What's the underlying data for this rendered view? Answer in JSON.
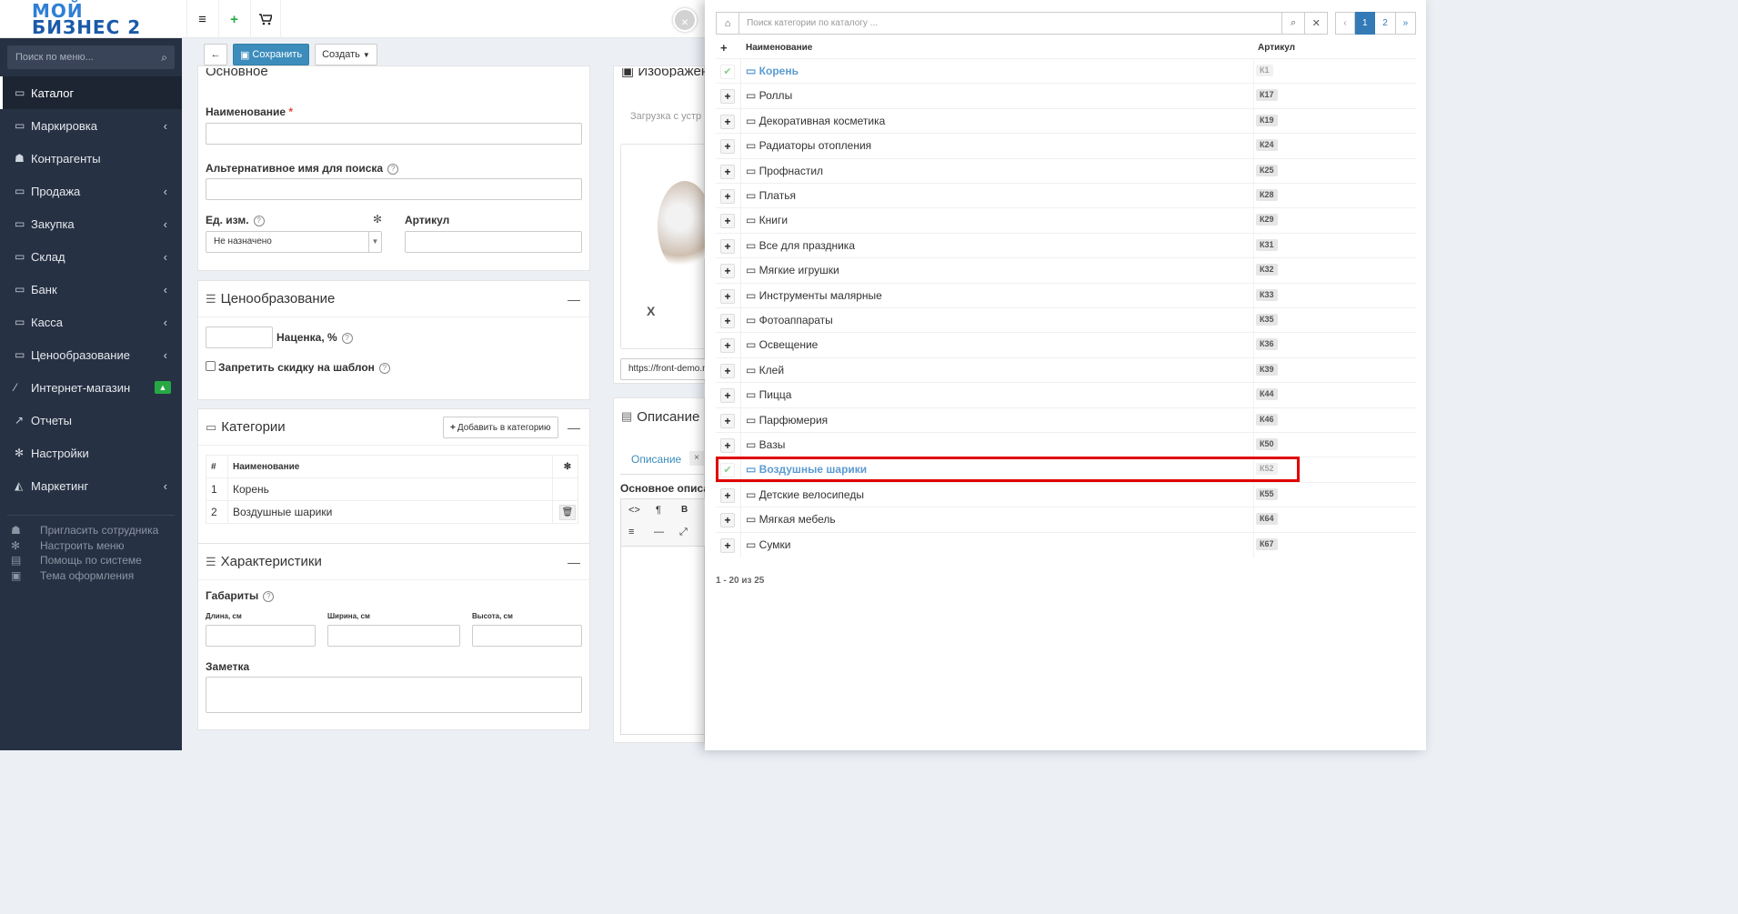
{
  "app": {
    "logo_line1": "МОЙ",
    "logo_line2": "БИЗНЕС 2"
  },
  "topbar": {
    "menu_icon": "hamburger-icon",
    "add_icon": "plus-icon",
    "cart_icon": "cart-icon"
  },
  "sidebar": {
    "search_placeholder": "Поиск по меню...",
    "items": [
      {
        "label": "Каталог",
        "icon": "folder-icon"
      },
      {
        "label": "Маркировка",
        "icon": "folder-icon"
      },
      {
        "label": "Контрагенты",
        "icon": "users-icon"
      },
      {
        "label": "Продажа",
        "icon": "folder-icon"
      },
      {
        "label": "Закупка",
        "icon": "folder-icon"
      },
      {
        "label": "Склад",
        "icon": "folder-icon"
      },
      {
        "label": "Банк",
        "icon": "folder-icon"
      },
      {
        "label": "Касса",
        "icon": "folder-icon"
      },
      {
        "label": "Ценообразование",
        "icon": "folder-icon"
      },
      {
        "label": "Интернет-магазин",
        "icon": "magic-icon"
      },
      {
        "label": "Отчеты",
        "icon": "chart-icon"
      },
      {
        "label": "Настройки",
        "icon": "gear-icon"
      },
      {
        "label": "Маркетинг",
        "icon": "area-chart-icon"
      }
    ],
    "footer": [
      {
        "label": "Пригласить сотрудника",
        "icon": "user-plus-icon"
      },
      {
        "label": "Настроить меню",
        "icon": "cogs-icon"
      },
      {
        "label": "Помощь по системе",
        "icon": "book-icon"
      },
      {
        "label": "Тема оформления",
        "icon": "image-icon"
      }
    ]
  },
  "toolbar": {
    "save_label": "Сохранить",
    "create_label": "Создать"
  },
  "basic": {
    "title": "Основное",
    "name_label": "Наименование",
    "alt_name_label": "Альтернативное имя для поиска",
    "unit_label": "Ед. изм.",
    "unit_value": "Не назначено",
    "article_label": "Артикул"
  },
  "pricing": {
    "title": "Ценообразование",
    "markup_label": "Наценка, %",
    "no_discount_label": "Запретить скидку на шаблон"
  },
  "categories": {
    "title": "Категории",
    "add_label": "Добавить в категорию",
    "col_num": "#",
    "col_name": "Наименование",
    "rows": [
      {
        "n": "1",
        "name": "Корень"
      },
      {
        "n": "2",
        "name": "Воздушные шарики"
      }
    ]
  },
  "characteristics": {
    "title": "Характеристики",
    "dims_label": "Габариты",
    "length_label": "Длина, см",
    "width_label": "Ширина, см",
    "height_label": "Высота, см",
    "note_label": "Заметка"
  },
  "images": {
    "title": "Изображения",
    "upload_label": "Загрузка с устр",
    "url_value": "https://front-demo.n",
    "remove": "X"
  },
  "description": {
    "title": "Описание",
    "tab_label": "Описание",
    "sub_label": "Основное описа"
  },
  "picker": {
    "search_placeholder": "Поиск категории по каталогу ...",
    "pages": [
      "‹",
      "1",
      "2",
      "»"
    ],
    "col_name": "Наименование",
    "col_article": "Артикул",
    "rows": [
      {
        "name": "Корень",
        "article": "К1",
        "selected": true
      },
      {
        "name": "Роллы",
        "article": "К17",
        "selected": false
      },
      {
        "name": "Декоративная косметика",
        "article": "К19",
        "selected": false
      },
      {
        "name": "Радиаторы отопления",
        "article": "К24",
        "selected": false
      },
      {
        "name": "Профнастил",
        "article": "К25",
        "selected": false
      },
      {
        "name": "Платья",
        "article": "К28",
        "selected": false
      },
      {
        "name": "Книги",
        "article": "К29",
        "selected": false
      },
      {
        "name": "Все для праздника",
        "article": "К31",
        "selected": false
      },
      {
        "name": "Мягкие игрушки",
        "article": "К32",
        "selected": false
      },
      {
        "name": "Инструменты малярные",
        "article": "К33",
        "selected": false
      },
      {
        "name": "Фотоаппараты",
        "article": "К35",
        "selected": false
      },
      {
        "name": "Освещение",
        "article": "К36",
        "selected": false
      },
      {
        "name": "Клей",
        "article": "К39",
        "selected": false
      },
      {
        "name": "Пицца",
        "article": "К44",
        "selected": false
      },
      {
        "name": "Парфюмерия",
        "article": "К46",
        "selected": false
      },
      {
        "name": "Вазы",
        "article": "К50",
        "selected": false
      },
      {
        "name": "Воздушные шарики",
        "article": "К52",
        "selected": true
      },
      {
        "name": "Детские велосипеды",
        "article": "К55",
        "selected": false
      },
      {
        "name": "Мягкая мебель",
        "article": "К64",
        "selected": false
      },
      {
        "name": "Сумки",
        "article": "К67",
        "selected": false
      }
    ],
    "footer": "1 - 20 из 25"
  }
}
